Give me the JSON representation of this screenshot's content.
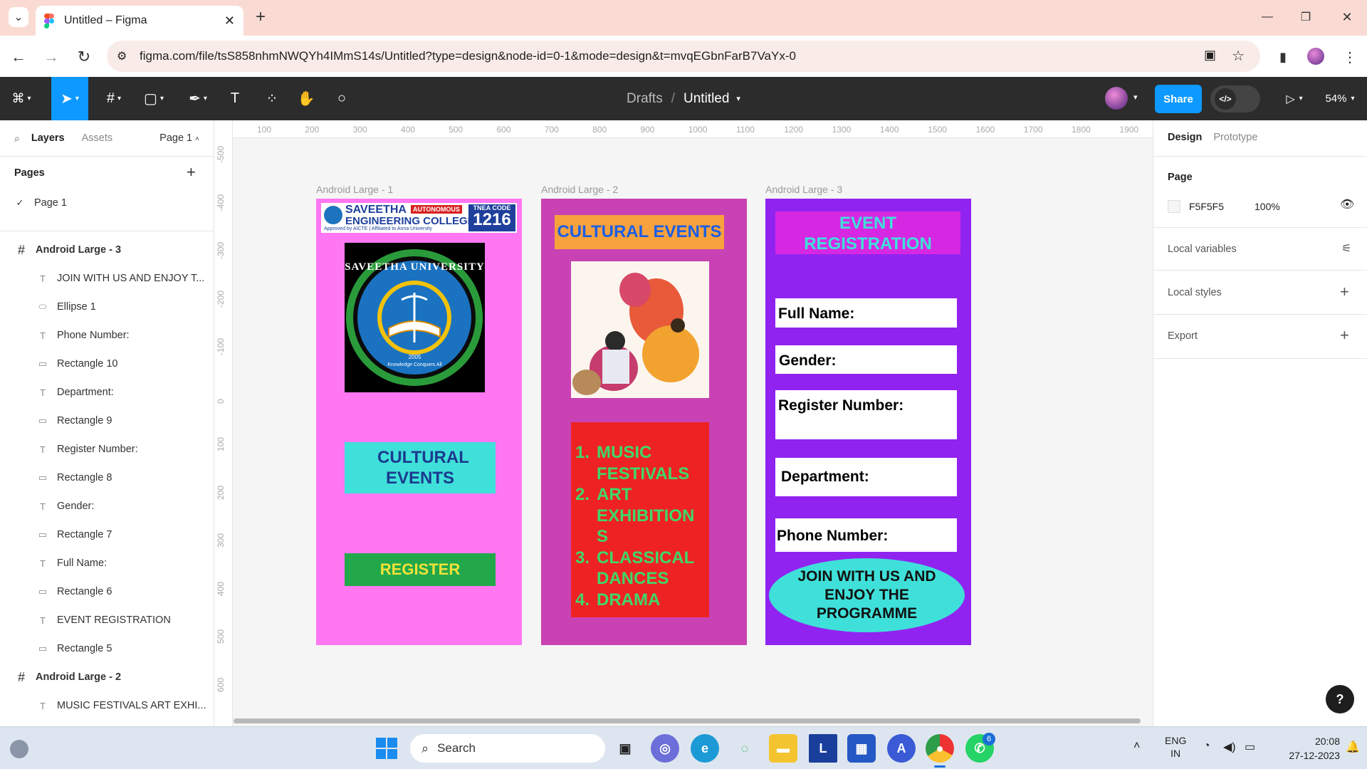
{
  "browser": {
    "tab_title": "Untitled – Figma",
    "url": "figma.com/file/tsS858nhmNWQYh4IMmS14s/Untitled?type=design&node-id=0-1&mode=design&t=mvqEGbnFarB7VaYx-0"
  },
  "toolbar": {
    "breadcrumb_parent": "Drafts",
    "breadcrumb_sep": "/",
    "file_name": "Untitled",
    "share_label": "Share",
    "zoom": "54%"
  },
  "left_panel": {
    "tab_layers": "Layers",
    "tab_assets": "Assets",
    "page_selector": "Page 1",
    "pages_heading": "Pages",
    "pages": [
      "Page 1"
    ],
    "layers": [
      {
        "name": "Android Large - 3",
        "type": "frame"
      },
      {
        "name": "JOIN WITH US AND ENJOY T...",
        "type": "text"
      },
      {
        "name": "Ellipse 1",
        "type": "ellipse"
      },
      {
        "name": "Phone Number:",
        "type": "text"
      },
      {
        "name": "Rectangle 10",
        "type": "rect"
      },
      {
        "name": "Department:",
        "type": "text"
      },
      {
        "name": "Rectangle 9",
        "type": "rect"
      },
      {
        "name": "Register Number:",
        "type": "text"
      },
      {
        "name": "Rectangle 8",
        "type": "rect"
      },
      {
        "name": "Gender:",
        "type": "text"
      },
      {
        "name": "Rectangle 7",
        "type": "rect"
      },
      {
        "name": "Full Name:",
        "type": "text"
      },
      {
        "name": "Rectangle 6",
        "type": "rect"
      },
      {
        "name": "EVENT REGISTRATION",
        "type": "text"
      },
      {
        "name": "Rectangle 5",
        "type": "rect"
      },
      {
        "name": "Android Large - 2",
        "type": "frame"
      },
      {
        "name": "MUSIC FESTIVALS ART EXHI...",
        "type": "text"
      }
    ]
  },
  "rulers": {
    "top": [
      "100",
      "200",
      "300",
      "400",
      "500",
      "600",
      "700",
      "800",
      "900",
      "1000",
      "1100",
      "1200",
      "1300",
      "1400",
      "1500",
      "1600",
      "1700",
      "1800",
      "1900"
    ],
    "left": [
      "-500",
      "-400",
      "-300",
      "-200",
      "-100",
      "0",
      "100",
      "200",
      "300",
      "400",
      "500",
      "600"
    ]
  },
  "frames": {
    "f1": {
      "label": "Android Large - 1",
      "college_name": "SAVEETHA",
      "college_line2": "ENGINEERING COLLEGE",
      "autonomous": "AUTONOMOUS",
      "approved": "Approved by AICTE | Affiliated to Anna University",
      "tnea_label": "TNEA CODE",
      "tnea_code": "1216",
      "seal_top": "SAVEETHA UNIVERSITY",
      "seal_year": "2005",
      "seal_motto": "Knowledge Conquers All",
      "cultural_events": "CULTURAL EVENTS",
      "register": "REGISTER",
      "bg": "#ff77f3"
    },
    "f2": {
      "label": "Android Large - 2",
      "title": "CULTURAL EVENTS",
      "events": [
        {
          "num": "1.",
          "lines": [
            "MUSIC",
            "FESTIVALS"
          ]
        },
        {
          "num": "2.",
          "lines": [
            "ART",
            "EXHIBITION",
            "S"
          ]
        },
        {
          "num": "3.",
          "lines": [
            "CLASSICAL",
            "DANCES"
          ]
        },
        {
          "num": "4.",
          "lines": [
            "DRAMA"
          ]
        }
      ],
      "bg": "#c942b4"
    },
    "f3": {
      "label": "Android Large - 3",
      "title_l1": "EVENT",
      "title_l2": "REGISTRATION",
      "fields": [
        "Full Name:",
        "Gender:",
        "Register Number:",
        "Department:",
        "Phone Number:"
      ],
      "cta_l1": "JOIN WITH US AND",
      "cta_l2": "ENJOY THE",
      "cta_l3": "PROGRAMME",
      "bg": "#9123f0"
    }
  },
  "right_panel": {
    "tab_design": "Design",
    "tab_prototype": "Prototype",
    "page_heading": "Page",
    "page_color": "F5F5F5",
    "page_opacity": "100%",
    "local_variables": "Local variables",
    "local_styles": "Local styles",
    "export": "Export",
    "help": "?"
  },
  "taskbar": {
    "search": "Search",
    "lang_l1": "ENG",
    "lang_l2": "IN",
    "time": "20:08",
    "date": "27-12-2023",
    "whatsapp_badge": "6"
  }
}
